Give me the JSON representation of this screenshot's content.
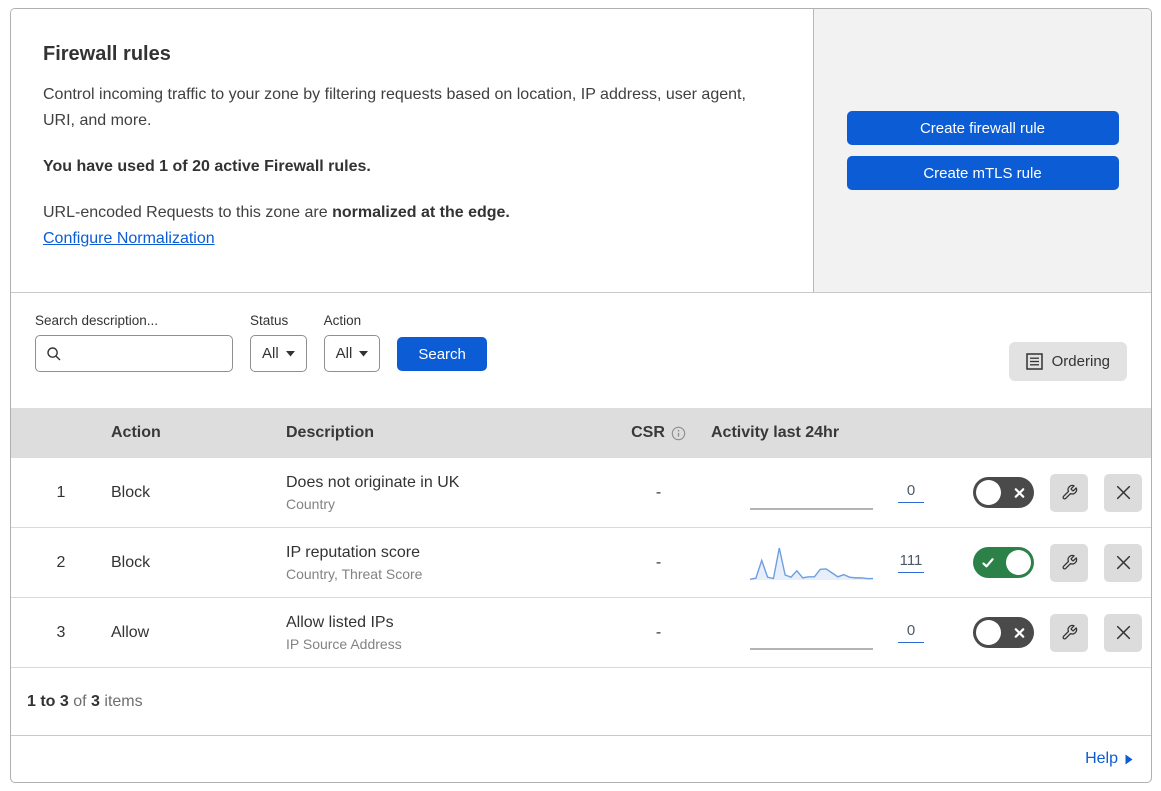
{
  "header": {
    "title": "Firewall rules",
    "description": "Control incoming traffic to your zone by filtering requests based on location, IP address, user agent, URI, and more.",
    "usage_notice": "You have used 1 of 20 active Firewall rules.",
    "normalization_prefix": "URL-encoded Requests to this zone are ",
    "normalization_bold": "normalized at the edge.",
    "normalization_link": "Configure Normalization",
    "create_firewall_button": "Create firewall rule",
    "create_mtls_button": "Create mTLS rule"
  },
  "filters": {
    "search_label": "Search description...",
    "status_label": "Status",
    "status_value": "All",
    "action_label": "Action",
    "action_value": "All",
    "search_button": "Search",
    "ordering_button": "Ordering"
  },
  "table": {
    "columns": {
      "action": "Action",
      "description": "Description",
      "csr": "CSR",
      "activity": "Activity last 24hr"
    },
    "rows": [
      {
        "index": "1",
        "action": "Block",
        "description": "Does not originate in UK",
        "fields": "Country",
        "csr": "-",
        "activity_count": "0",
        "enabled": false,
        "activity_values": [
          0,
          0,
          0,
          0,
          0,
          0,
          0,
          0,
          0,
          0,
          0,
          0,
          0,
          0,
          0,
          0,
          0,
          0,
          0,
          0,
          0,
          0
        ]
      },
      {
        "index": "2",
        "action": "Block",
        "description": "IP reputation score",
        "fields": "Country, Threat Score",
        "csr": "-",
        "activity_count": "111",
        "enabled": true,
        "activity_values": [
          2,
          5,
          55,
          8,
          4,
          90,
          14,
          8,
          26,
          6,
          9,
          9,
          30,
          31,
          20,
          9,
          15,
          8,
          6,
          6,
          4,
          4
        ]
      },
      {
        "index": "3",
        "action": "Allow",
        "description": "Allow listed IPs",
        "fields": "IP Source Address",
        "csr": "-",
        "activity_count": "0",
        "enabled": false,
        "activity_values": [
          0,
          0,
          0,
          0,
          0,
          0,
          0,
          0,
          0,
          0,
          0,
          0,
          0,
          0,
          0,
          0,
          0,
          0,
          0,
          0,
          0,
          0
        ]
      }
    ]
  },
  "footer": {
    "range_text": "1 to 3",
    "of_text": "of",
    "total_text": "3",
    "items_text": "items",
    "help_label": "Help"
  },
  "icons": {
    "search": "magnifier",
    "dropdown_caret": "triangle-down",
    "ordering": "list-document",
    "csr_info": "info-circle",
    "toggle_on": "checkmark",
    "toggle_off": "cross",
    "edit": "wrench",
    "delete": "x-cross",
    "help_arrow": "triangle-right"
  },
  "colors": {
    "accent_blue": "#0b5cd5",
    "link_blue": "#0b5cd5",
    "toggle_on_green": "#2c8149",
    "toggle_off_gray": "#4a4a4a",
    "sparkline_blue": "#6d9fe0",
    "sparkline_fill": "rgba(130,165,225,0.18)",
    "flatline_gray": "#9b9b9b",
    "table_header_bg": "#dddddd",
    "panel_gray": "#f2f2f2"
  }
}
